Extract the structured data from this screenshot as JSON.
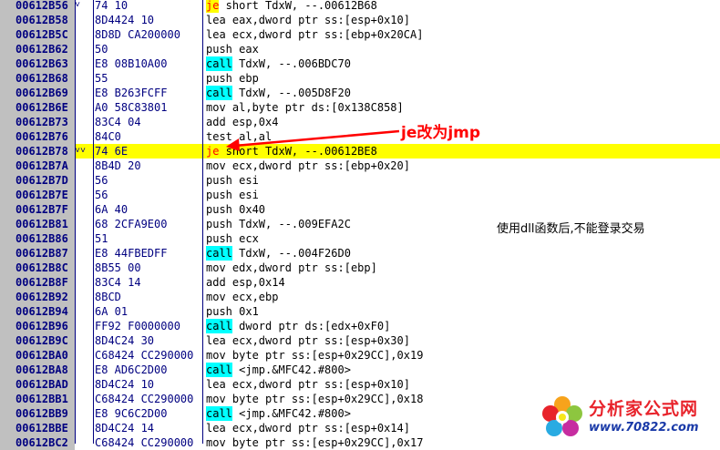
{
  "rows": [
    {
      "addr": "00612B56",
      "jump": "˅",
      "hex": "74 10",
      "mnemonic": "je",
      "operands": " short TdxW, --.00612B68",
      "kind": "je"
    },
    {
      "addr": "00612B58",
      "jump": "",
      "hex": "8D4424 10",
      "mnemonic": "lea",
      "operands": " eax,dword ptr ss:[esp+0x10]",
      "kind": ""
    },
    {
      "addr": "00612B5C",
      "jump": "",
      "hex": "8D8D CA200000",
      "mnemonic": "lea",
      "operands": " ecx,dword ptr ss:[ebp+0x20CA]",
      "kind": ""
    },
    {
      "addr": "00612B62",
      "jump": "",
      "hex": "50",
      "mnemonic": "push",
      "operands": " eax",
      "kind": ""
    },
    {
      "addr": "00612B63",
      "jump": "",
      "hex": "E8 08B10A00",
      "mnemonic": "call",
      "operands": " TdxW, --.006BDC70",
      "kind": "call"
    },
    {
      "addr": "00612B68",
      "jump": "",
      "hex": "55",
      "mnemonic": "push",
      "operands": " ebp",
      "kind": ""
    },
    {
      "addr": "00612B69",
      "jump": "",
      "hex": "E8 B263FCFF",
      "mnemonic": "call",
      "operands": " TdxW, --.005D8F20",
      "kind": "call"
    },
    {
      "addr": "00612B6E",
      "jump": "",
      "hex": "A0 58C83801",
      "mnemonic": "mov",
      "operands": " al,byte ptr ds:[0x138C858]",
      "kind": ""
    },
    {
      "addr": "00612B73",
      "jump": "",
      "hex": "83C4 04",
      "mnemonic": "add",
      "operands": " esp,0x4",
      "kind": ""
    },
    {
      "addr": "00612B76",
      "jump": "",
      "hex": "84C0",
      "mnemonic": "test",
      "operands": " al,al",
      "kind": ""
    },
    {
      "addr": "00612B78",
      "jump": "˅˅",
      "hex": "74 6E",
      "mnemonic": "je",
      "operands": " short TdxW, --.00612BE8",
      "kind": "je",
      "highlight": true
    },
    {
      "addr": "00612B7A",
      "jump": "",
      "hex": "8B4D 20",
      "mnemonic": "mov",
      "operands": " ecx,dword ptr ss:[ebp+0x20]",
      "kind": ""
    },
    {
      "addr": "00612B7D",
      "jump": "",
      "hex": "56",
      "mnemonic": "push",
      "operands": " esi",
      "kind": ""
    },
    {
      "addr": "00612B7E",
      "jump": "",
      "hex": "56",
      "mnemonic": "push",
      "operands": " esi",
      "kind": ""
    },
    {
      "addr": "00612B7F",
      "jump": "",
      "hex": "6A 40",
      "mnemonic": "push",
      "operands": " 0x40",
      "kind": ""
    },
    {
      "addr": "00612B81",
      "jump": "",
      "hex": "68 2CFA9E00",
      "mnemonic": "push",
      "operands": " TdxW, --.009EFA2C",
      "kind": ""
    },
    {
      "addr": "00612B86",
      "jump": "",
      "hex": "51",
      "mnemonic": "push",
      "operands": " ecx",
      "kind": ""
    },
    {
      "addr": "00612B87",
      "jump": "",
      "hex": "E8 44FBEDFF",
      "mnemonic": "call",
      "operands": " TdxW, --.004F26D0",
      "kind": "call"
    },
    {
      "addr": "00612B8C",
      "jump": "",
      "hex": "8B55 00",
      "mnemonic": "mov",
      "operands": " edx,dword ptr ss:[ebp]",
      "kind": ""
    },
    {
      "addr": "00612B8F",
      "jump": "",
      "hex": "83C4 14",
      "mnemonic": "add",
      "operands": " esp,0x14",
      "kind": ""
    },
    {
      "addr": "00612B92",
      "jump": "",
      "hex": "8BCD",
      "mnemonic": "mov",
      "operands": " ecx,ebp",
      "kind": ""
    },
    {
      "addr": "00612B94",
      "jump": "",
      "hex": "6A 01",
      "mnemonic": "push",
      "operands": " 0x1",
      "kind": ""
    },
    {
      "addr": "00612B96",
      "jump": "",
      "hex": "FF92 F0000000",
      "mnemonic": "call",
      "operands": " dword ptr ds:[edx+0xF0]",
      "kind": "call"
    },
    {
      "addr": "00612B9C",
      "jump": "",
      "hex": "8D4C24 30",
      "mnemonic": "lea",
      "operands": " ecx,dword ptr ss:[esp+0x30]",
      "kind": ""
    },
    {
      "addr": "00612BA0",
      "jump": "",
      "hex": "C68424 CC290000",
      "mnemonic": "mov",
      "operands": " byte ptr ss:[esp+0x29CC],0x19",
      "kind": ""
    },
    {
      "addr": "00612BA8",
      "jump": "",
      "hex": "E8 AD6C2D00",
      "mnemonic": "call",
      "operands": " <jmp.&MFC42.#800>",
      "kind": "call"
    },
    {
      "addr": "00612BAD",
      "jump": "",
      "hex": "8D4C24 10",
      "mnemonic": "lea",
      "operands": " ecx,dword ptr ss:[esp+0x10]",
      "kind": ""
    },
    {
      "addr": "00612BB1",
      "jump": "",
      "hex": "C68424 CC290000",
      "mnemonic": "mov",
      "operands": " byte ptr ss:[esp+0x29CC],0x18",
      "kind": ""
    },
    {
      "addr": "00612BB9",
      "jump": "",
      "hex": "E8 9C6C2D00",
      "mnemonic": "call",
      "operands": " <jmp.&MFC42.#800>",
      "kind": "call"
    },
    {
      "addr": "00612BBE",
      "jump": "",
      "hex": "8D4C24 14",
      "mnemonic": "lea",
      "operands": " ecx,dword ptr ss:[esp+0x14]",
      "kind": ""
    },
    {
      "addr": "00612BC2",
      "jump": "",
      "hex": "C68424 CC290000",
      "mnemonic": "mov",
      "operands": " byte ptr ss:[esp+0x29CC],0x17",
      "kind": ""
    }
  ],
  "annotations": {
    "jmp_note": "je改为jmp",
    "dll_note": "使用dll函数后,不能登录交易"
  },
  "watermark": {
    "title": "分析家公式网",
    "url": "www.70822.com"
  },
  "colors": {
    "highlight_row": "#ffff00",
    "call_bg": "#00ffff",
    "je_text": "#ff0000",
    "annotation": "#ff0000"
  }
}
